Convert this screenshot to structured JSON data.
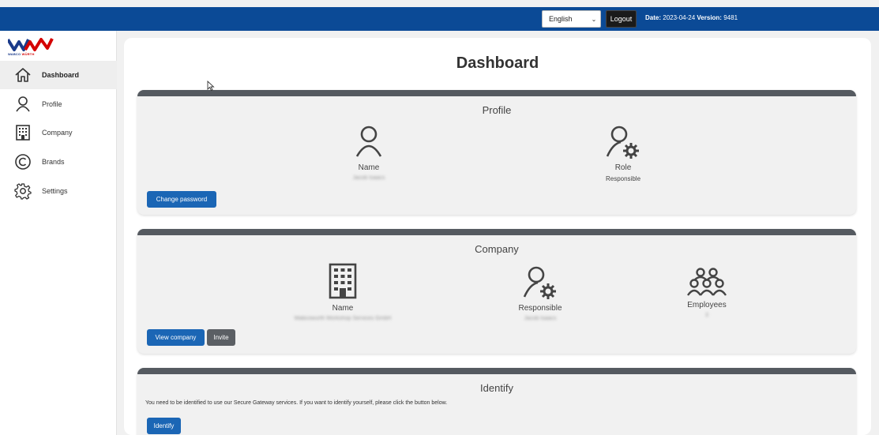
{
  "topbar": {
    "language": "English",
    "logout_label": "Logout",
    "date_label": "Date:",
    "date_value": "2023-04-24",
    "version_label": "Version:",
    "version_value": "9481",
    "color": "#0b4a96"
  },
  "brand": {
    "wabco": "WABCO",
    "wurth": "WÜRTH"
  },
  "sidebar": {
    "items": [
      {
        "label": "Dashboard",
        "icon": "home-icon",
        "active": true
      },
      {
        "label": "Profile",
        "icon": "user-icon",
        "active": false
      },
      {
        "label": "Company",
        "icon": "building-icon",
        "active": false
      },
      {
        "label": "Brands",
        "icon": "copyright-icon",
        "active": false
      },
      {
        "label": "Settings",
        "icon": "gear-icon",
        "active": false
      }
    ]
  },
  "page": {
    "title": "Dashboard"
  },
  "profile_card": {
    "title": "Profile",
    "name_label": "Name",
    "name_value": "Jacob Isaacs",
    "role_label": "Role",
    "role_value": "Responsible",
    "change_password_label": "Change password"
  },
  "company_card": {
    "title": "Company",
    "name_label": "Name",
    "name_value": "Wabcowurth Workshop Services GmbH",
    "responsible_label": "Responsible",
    "responsible_value": "Jacob Isaacs",
    "employees_label": "Employees",
    "employees_value": "3",
    "view_company_label": "View company",
    "invite_label": "Invite"
  },
  "identify_card": {
    "title": "Identify",
    "notice": "You need to be identified to use our Secure Gateway services. If you want to identify yourself, please click the button below.",
    "identify_label": "Identify"
  },
  "colors": {
    "primary_button": "#1b66b5",
    "secondary_button": "#5b5f64",
    "card_header": "#555a60"
  }
}
